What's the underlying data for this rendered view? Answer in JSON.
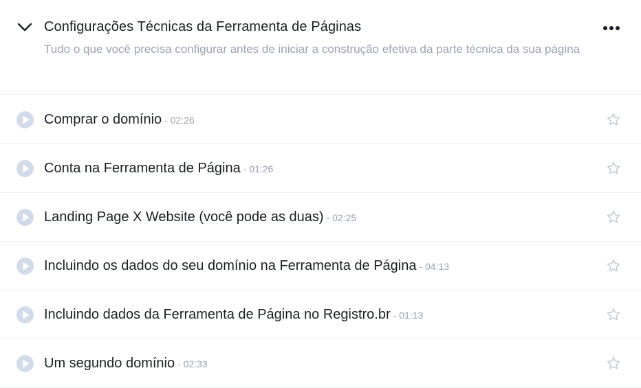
{
  "section": {
    "title": "Configurações Técnicas da Ferramenta de Páginas",
    "description": "Tudo o que você precisa configurar antes de iniciar a construção efetiva da parte técnica da sua página",
    "collapse_icon": "chevron-down-icon",
    "menu_icon": "more-horizontal-icon"
  },
  "lessons": [
    {
      "title": "Comprar o domínio",
      "duration": "- 02:26"
    },
    {
      "title": "Conta na Ferramenta de Página",
      "duration": "- 01:26"
    },
    {
      "title": "Landing Page X Website (você pode as duas)",
      "duration": "- 02:25"
    },
    {
      "title": "Incluindo os dados do seu domínio na Ferramenta de Página",
      "duration": "- 04:13"
    },
    {
      "title": "Incluindo dados da Ferramenta de Página no Registro.br",
      "duration": "- 01:13"
    },
    {
      "title": "Um segundo domínio",
      "duration": "- 02:33"
    }
  ],
  "icons": {
    "play": "play-circle-icon",
    "favorite": "star-outline-icon"
  },
  "colors": {
    "title_text": "#1b1f24",
    "muted_text": "#9aa2b1",
    "play_circle": "#d3dbe8",
    "star_outline": "#c4cad4",
    "divider": "#eef0f3"
  }
}
